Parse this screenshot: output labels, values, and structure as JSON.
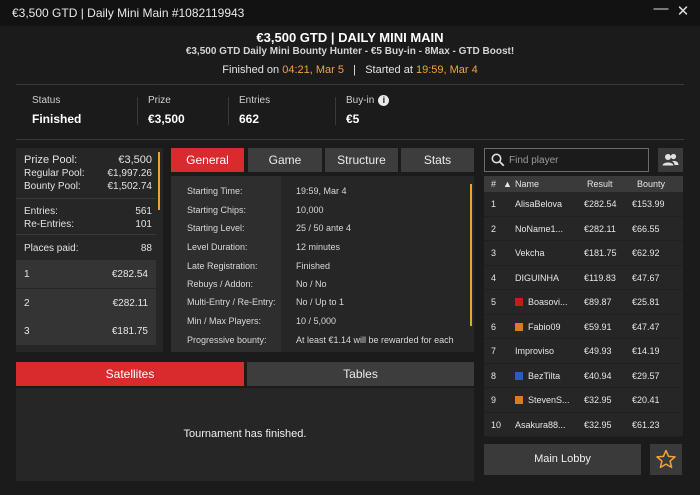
{
  "window": {
    "title": "€3,500 GTD | Daily Mini Main #1082119943",
    "minimize_glyph": "—",
    "close_glyph": "✕"
  },
  "header": {
    "title": "€3,500 GTD | DAILY MINI MAIN",
    "subtitle": "€3,500 GTD Daily Mini Bounty Hunter - €5 Buy-in - 8Max - GTD Boost!",
    "finished_label": "Finished on",
    "finished_value": "04:21, Mar 5",
    "separator": "|",
    "started_label": "Started at",
    "started_value": "19:59, Mar 4"
  },
  "stats": [
    {
      "label": "Status",
      "value": "Finished"
    },
    {
      "label": "Prize",
      "value": "€3,500"
    },
    {
      "label": "Entries",
      "value": "662"
    },
    {
      "label": "Buy-in",
      "value": "€5",
      "icon": "info-icon"
    }
  ],
  "prize_info": {
    "prize_pool_label": "Prize Pool:",
    "prize_pool": "€3,500",
    "regular_pool_label": "Regular Pool:",
    "regular_pool": "€1,997.26",
    "bounty_pool_label": "Bounty Pool:",
    "bounty_pool": "€1,502.74",
    "entries_label": "Entries:",
    "entries": "561",
    "reentries_label": "Re-Entries:",
    "reentries": "101",
    "places_label": "Places paid:",
    "places": "88",
    "payouts": [
      {
        "place": "1",
        "amount": "€282.54"
      },
      {
        "place": "2",
        "amount": "€282.11"
      },
      {
        "place": "3",
        "amount": "€181.75"
      }
    ]
  },
  "tabs": [
    {
      "label": "General",
      "active": true
    },
    {
      "label": "Game",
      "active": false
    },
    {
      "label": "Structure",
      "active": false
    },
    {
      "label": "Stats",
      "active": false
    }
  ],
  "general": [
    {
      "key": "Starting Time:",
      "value": "19:59, Mar 4"
    },
    {
      "key": "Starting Chips:",
      "value": "10,000"
    },
    {
      "key": "Starting Level:",
      "value": "25 / 50 ante 4"
    },
    {
      "key": "Level Duration:",
      "value": "12 minutes"
    },
    {
      "key": "Late Registration:",
      "value": "Finished"
    },
    {
      "key": "Rebuys / Addon:",
      "value": "No / No"
    },
    {
      "key": "Multi-Entry / Re-Entry:",
      "value": "No / Up to 1"
    },
    {
      "key": "Min / Max Players:",
      "value": "10 / 5,000"
    },
    {
      "key": "Progressive bounty:",
      "value": "At least €1.14 will be rewarded for each"
    }
  ],
  "bottom_tabs": [
    {
      "label": "Satellites",
      "active": true
    },
    {
      "label": "Tables",
      "active": false
    }
  ],
  "satellites_message": "Tournament has finished.",
  "search": {
    "placeholder": "Find player"
  },
  "players_table": {
    "headers": {
      "rank": "#",
      "name": "Name",
      "result": "Result",
      "bounty": "Bounty"
    },
    "rows": [
      {
        "rank": "1",
        "name": "AlisaBelova",
        "result": "€282.54",
        "bounty": "€153.99",
        "flag": ""
      },
      {
        "rank": "2",
        "name": "NoName1...",
        "result": "€282.11",
        "bounty": "€66.55",
        "flag": ""
      },
      {
        "rank": "3",
        "name": "Vekcha",
        "result": "€181.75",
        "bounty": "€62.92",
        "flag": ""
      },
      {
        "rank": "4",
        "name": "DIGUINHA",
        "result": "€119.83",
        "bounty": "€47.67",
        "flag": ""
      },
      {
        "rank": "5",
        "name": "Boasovi...",
        "result": "€89.87",
        "bounty": "€25.81",
        "flag": "#c8191b"
      },
      {
        "rank": "6",
        "name": "Fabio09",
        "result": "€59.91",
        "bounty": "€47.47",
        "flag": "#e07a1f"
      },
      {
        "rank": "7",
        "name": "Improviso",
        "result": "€49.93",
        "bounty": "€14.19",
        "flag": ""
      },
      {
        "rank": "8",
        "name": "BezTilta",
        "result": "€40.94",
        "bounty": "€29.57",
        "flag": "#2a59c9"
      },
      {
        "rank": "9",
        "name": "StevenS...",
        "result": "€32.95",
        "bounty": "€20.41",
        "flag": "#e07a1f"
      },
      {
        "rank": "10",
        "name": "Asakura88...",
        "result": "€32.95",
        "bounty": "€61.23",
        "flag": ""
      }
    ]
  },
  "buttons": {
    "main_lobby": "Main Lobby"
  },
  "colors": {
    "accent_red": "#d92b2e",
    "highlight_orange": "#f2a33a"
  }
}
